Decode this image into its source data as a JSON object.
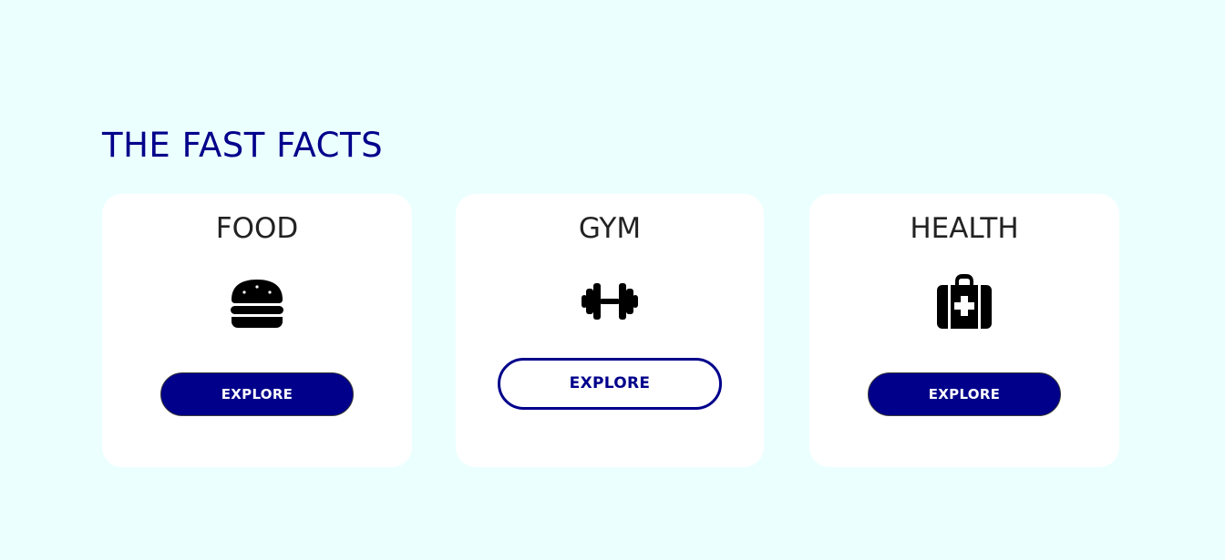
{
  "section": {
    "title": "THE FAST FACTS"
  },
  "cards": [
    {
      "title": "FOOD",
      "icon": "burger-icon",
      "button_label": "EXPLORE"
    },
    {
      "title": "GYM",
      "icon": "dumbbell-icon",
      "button_label": "EXPLORE"
    },
    {
      "title": "HEALTH",
      "icon": "medical-kit-icon",
      "button_label": "EXPLORE"
    }
  ],
  "colors": {
    "background": "#ecffff",
    "accent": "#00008b",
    "card": "#ffffff",
    "card_title": "#222222"
  }
}
